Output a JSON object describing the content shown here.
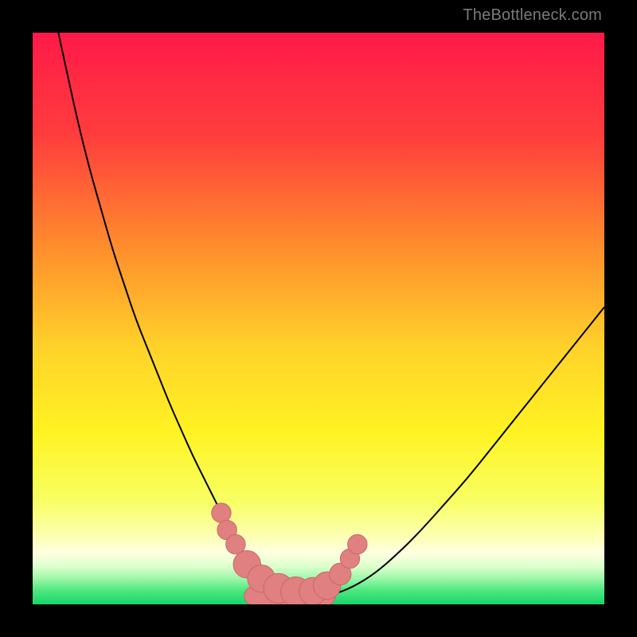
{
  "watermark": "TheBottleneck.com",
  "chart_data": {
    "type": "line",
    "title": "",
    "xlabel": "",
    "ylabel": "",
    "xlim": [
      0,
      100
    ],
    "ylim": [
      0,
      100
    ],
    "grid": false,
    "legend": false,
    "background_gradient_stops": [
      {
        "pct": 0,
        "color": "#ff1a49"
      },
      {
        "pct": 18,
        "color": "#ff3d3d"
      },
      {
        "pct": 38,
        "color": "#ff8f2c"
      },
      {
        "pct": 55,
        "color": "#ffd22a"
      },
      {
        "pct": 70,
        "color": "#fff323"
      },
      {
        "pct": 82,
        "color": "#f8ff63"
      },
      {
        "pct": 88,
        "color": "#fcffb0"
      },
      {
        "pct": 91,
        "color": "#ffffe2"
      },
      {
        "pct": 93.5,
        "color": "#d9ffca"
      },
      {
        "pct": 95.5,
        "color": "#9cf7a9"
      },
      {
        "pct": 97.5,
        "color": "#4fe87f"
      },
      {
        "pct": 100,
        "color": "#17d66a"
      }
    ],
    "series": [
      {
        "name": "bottleneck-curve",
        "color": "#000000",
        "stroke_width": 2,
        "x": [
          4.5,
          6,
          8,
          10,
          12,
          14,
          16,
          18,
          20,
          22,
          24,
          26,
          28,
          30,
          32,
          33.5,
          35,
          37,
          40,
          44,
          48,
          52,
          56,
          60,
          64,
          68,
          72,
          76,
          80,
          84,
          88,
          92,
          96,
          100
        ],
        "y": [
          100,
          93,
          84,
          76,
          69,
          62,
          56,
          50,
          45,
          40,
          35,
          30.5,
          26,
          22,
          18,
          15,
          12,
          9,
          5.5,
          2.5,
          1,
          1.5,
          3,
          5.5,
          9,
          13,
          17.5,
          22,
          27,
          32,
          37,
          42,
          47,
          52
        ]
      }
    ],
    "markers": {
      "name": "trough-beads",
      "color": "#e08080",
      "stroke": "#c86868",
      "points": [
        {
          "x": 33.0,
          "y": 16.0,
          "r": 1.7
        },
        {
          "x": 34.0,
          "y": 13.0,
          "r": 1.7
        },
        {
          "x": 35.5,
          "y": 10.5,
          "r": 1.7
        },
        {
          "x": 37.5,
          "y": 7.0,
          "r": 2.4
        },
        {
          "x": 40.0,
          "y": 4.5,
          "r": 2.4
        },
        {
          "x": 43.0,
          "y": 2.8,
          "r": 2.6
        },
        {
          "x": 46.0,
          "y": 2.2,
          "r": 2.6
        },
        {
          "x": 49.0,
          "y": 2.3,
          "r": 2.4
        },
        {
          "x": 51.5,
          "y": 3.3,
          "r": 2.4
        },
        {
          "x": 53.8,
          "y": 5.3,
          "r": 1.9
        },
        {
          "x": 55.5,
          "y": 8.0,
          "r": 1.7
        },
        {
          "x": 56.8,
          "y": 10.5,
          "r": 1.7
        }
      ],
      "base_bar": {
        "x0": 37,
        "x1": 53,
        "y": 1.5,
        "h": 3.2
      }
    }
  }
}
